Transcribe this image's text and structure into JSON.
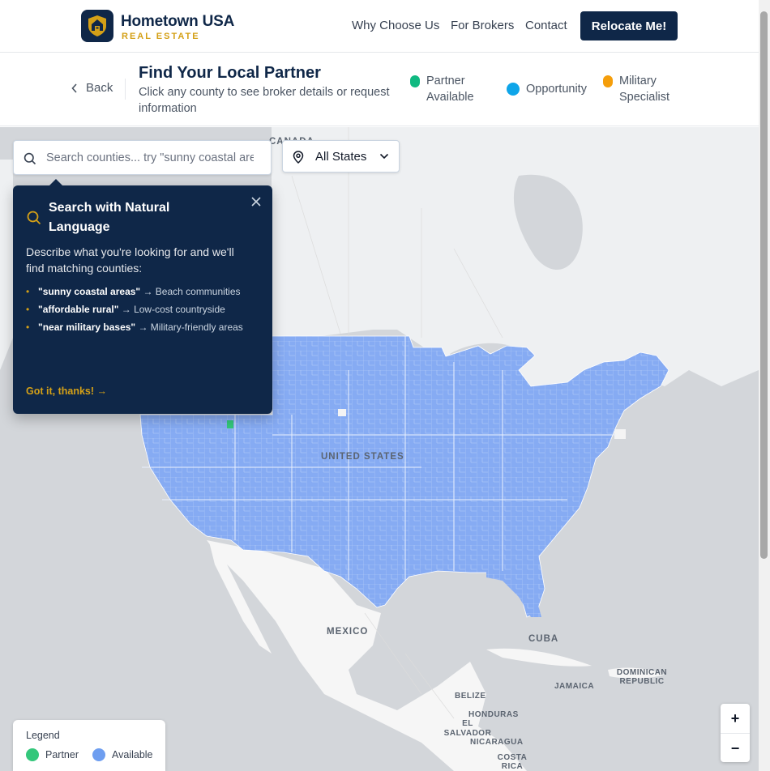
{
  "header": {
    "brand_name": "Hometown USA",
    "brand_sub": "REAL ESTATE",
    "nav": [
      "Why Choose Us",
      "For Brokers",
      "Contact"
    ],
    "cta": "Relocate Me!"
  },
  "subheader": {
    "back": "Back",
    "title": "Find Your Local Partner",
    "description": "Click any county to see broker details or request information",
    "legend": [
      {
        "label": "Partner Available",
        "color": "#10b981"
      },
      {
        "label": "Opportunity",
        "color": "#0ea5e9"
      },
      {
        "label": "Military Specialist",
        "color": "#f59e0b"
      }
    ]
  },
  "search": {
    "placeholder": "Search counties... try \"sunny coastal areas\""
  },
  "state_filter": {
    "value": "All States"
  },
  "tooltip": {
    "title": "Search with Natural Language",
    "description": "Describe what you're looking for and we'll find matching counties:",
    "examples": [
      {
        "query": "\"sunny coastal areas\"",
        "result": "Beach communities"
      },
      {
        "query": "\"affordable rural\"",
        "result": "Low-cost countryside"
      },
      {
        "query": "\"near military bases\"",
        "result": "Military-friendly areas"
      }
    ],
    "dismiss": "Got it, thanks! →"
  },
  "map": {
    "labels": {
      "canada": "CANADA",
      "united_states": "UNITED STATES",
      "mexico": "MEXICO",
      "cuba": "CUBA",
      "dominican_republic": "DOMINICAN REPUBLIC",
      "jamaica": "JAMAICA",
      "belize": "BELIZE",
      "honduras": "HONDURAS",
      "el_salvador": "EL SALVADOR",
      "nicaragua": "NICARAGUA",
      "costa_rica": "COSTA RICA"
    },
    "colors": {
      "available": "#86abf3",
      "partner": "#34c77b",
      "water": "#d3d6da",
      "land": "#eef0f2"
    }
  },
  "legend_box": {
    "title": "Legend",
    "items": [
      {
        "label": "Partner",
        "color": "#34c77b"
      },
      {
        "label": "Available",
        "color": "#6e9ef0"
      }
    ]
  },
  "zoom": {
    "in": "+",
    "out": "−"
  }
}
